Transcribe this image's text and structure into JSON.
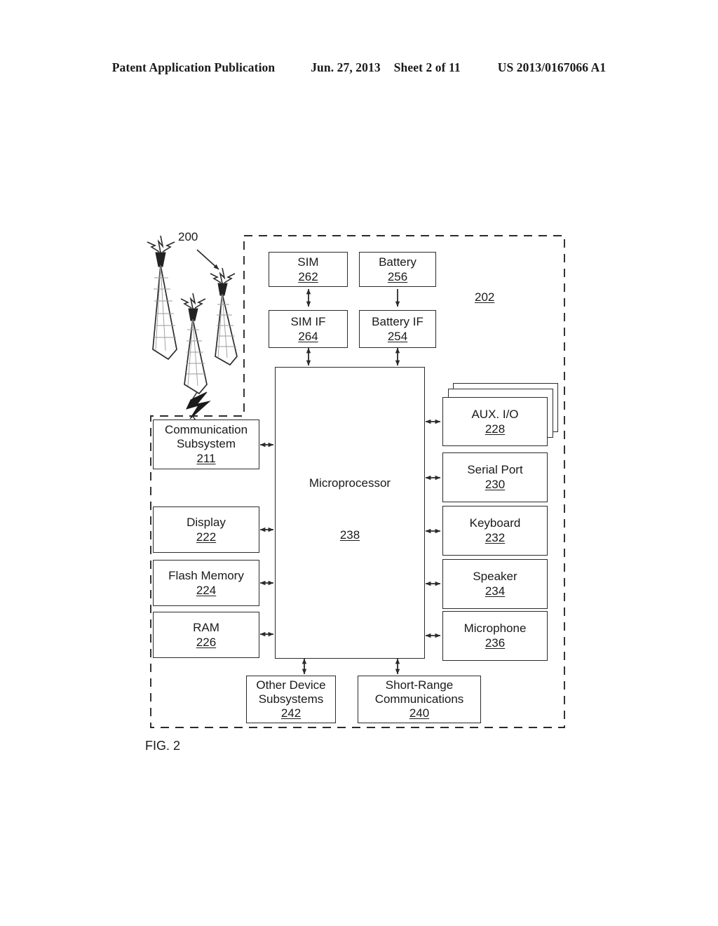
{
  "header": {
    "publication": "Patent Application Publication",
    "date": "Jun. 27, 2013",
    "sheet": "Sheet 2 of 11",
    "pub_number": "US 2013/0167066 A1"
  },
  "figure": {
    "caption": "FIG. 2",
    "network_ref": "200",
    "device_ref": "202",
    "nodes": {
      "sim": {
        "label": "SIM",
        "ref": "262"
      },
      "battery": {
        "label": "Battery",
        "ref": "256"
      },
      "sim_if": {
        "label": "SIM IF",
        "ref": "264"
      },
      "battery_if": {
        "label": "Battery IF",
        "ref": "254"
      },
      "microprocessor": {
        "label": "Microprocessor",
        "ref": "238"
      },
      "comm_subsystem": {
        "label": "Communication\nSubsystem",
        "ref": "211"
      },
      "display": {
        "label": "Display",
        "ref": "222"
      },
      "flash": {
        "label": "Flash Memory",
        "ref": "224"
      },
      "ram": {
        "label": "RAM",
        "ref": "226"
      },
      "aux_io": {
        "label": "AUX. I/O",
        "ref": "228"
      },
      "serial_port": {
        "label": "Serial Port",
        "ref": "230"
      },
      "keyboard": {
        "label": "Keyboard",
        "ref": "232"
      },
      "speaker": {
        "label": "Speaker",
        "ref": "234"
      },
      "microphone": {
        "label": "Microphone",
        "ref": "236"
      },
      "other_subsystems": {
        "label": "Other Device\nSubsystems",
        "ref": "242"
      },
      "short_range": {
        "label": "Short-Range\nCommunications",
        "ref": "240"
      }
    },
    "colors": {
      "ink": "#1a1a1a",
      "line": "#2b2b2b",
      "background": "#ffffff"
    }
  }
}
